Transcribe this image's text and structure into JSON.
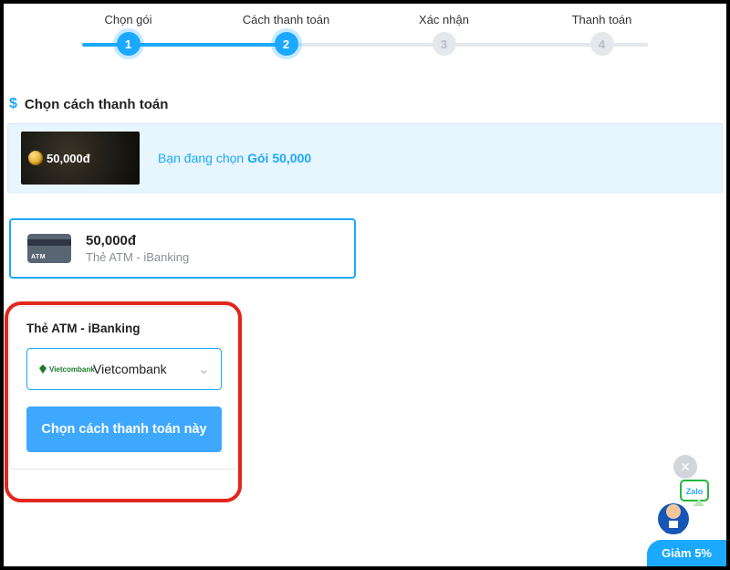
{
  "progress": {
    "steps": [
      {
        "label": "Chọn gói",
        "num": 1,
        "state": "active"
      },
      {
        "label": "Cách thanh toán",
        "num": 2,
        "state": "active"
      },
      {
        "label": "Xác nhận",
        "num": 3,
        "state": "inactive"
      },
      {
        "label": "Thanh toán",
        "num": 4,
        "state": "inactive"
      }
    ]
  },
  "section": {
    "title": "Chọn cách thanh toán"
  },
  "selected_pack": {
    "price_overlay": "50,000đ",
    "prefix_text": "Bạn đang chọn ",
    "name": "Gói 50,000"
  },
  "method": {
    "price": "50,000đ",
    "subtitle": "Thẻ ATM - iBanking",
    "atm_label": "ATM"
  },
  "bank_panel": {
    "title": "Thẻ ATM - iBanking",
    "bank_logo_text": "Vietcombank",
    "bank_name": "Vietcombank",
    "button_label": "Chọn cách thanh toán này"
  },
  "discount_pill": "Giảm 5%",
  "icons": {
    "dollar": "$",
    "close": "✕",
    "chevron_down": "⌄"
  },
  "colors": {
    "accent": "#1ba8ff",
    "highlight_red": "#e1261c"
  }
}
